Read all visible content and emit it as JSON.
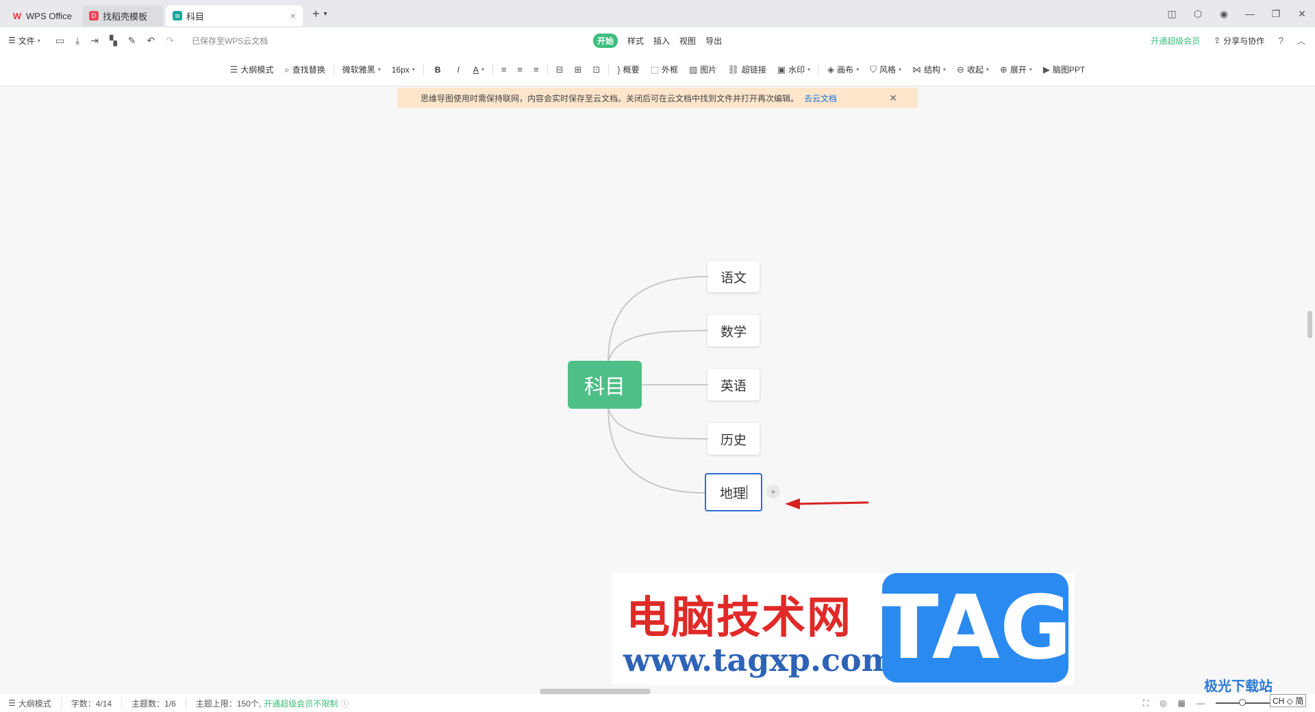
{
  "tabs": [
    {
      "label": "WPS Office",
      "icon": "wps-logo-icon"
    },
    {
      "label": "找稻壳模板",
      "icon": "docer-logo-icon"
    },
    {
      "label": "科目",
      "icon": "mindmap-file-icon"
    }
  ],
  "menubar": {
    "file_label": "文件",
    "saved_status": "已保存至WPS云文档",
    "tabs": [
      "开始",
      "样式",
      "插入",
      "视图",
      "导出"
    ],
    "active_tab": "开始",
    "vip_label": "开通超级会员",
    "share_label": "分享与协作"
  },
  "toolbar": {
    "outline_mode": "大纲模式",
    "find_replace": "查找替换",
    "font_family": "微软雅黑",
    "font_size": "16px",
    "bold": "B",
    "italic": "I",
    "font_color": "A",
    "summary": "概要",
    "frame": "外框",
    "image": "图片",
    "hyperlink": "超链接",
    "watermark": "水印",
    "canvas": "画布",
    "style": "风格",
    "structure": "结构",
    "collapse": "收起",
    "expand": "展开",
    "mind_ppt": "脑图PPT"
  },
  "notice": {
    "text": "思维导图使用时需保持联网，内容会实时保存至云文档。关闭后可在云文档中找到文件并打开再次编辑。",
    "link": "去云文档"
  },
  "mindmap": {
    "root": "科目",
    "children": [
      "语文",
      "数学",
      "英语",
      "历史",
      "地理"
    ],
    "selected": "地理",
    "root_color": "#4fbf88",
    "selection_color": "#2a6bd8",
    "arrow_color": "#d82020"
  },
  "watermark": {
    "cn_text": "电脑技术网",
    "url": "www.tagxp.com",
    "tag": "TAG"
  },
  "statusbar": {
    "outline_mode": "大纲模式",
    "word_count": "字数：4/14",
    "topic_count": "主题数：1/6",
    "topic_limit": "主题上限：150个,",
    "vip_unlimited": "开通超级会员不限制"
  },
  "brand": {
    "text": "极光下载站",
    "badge": "CH ◇ 简"
  }
}
